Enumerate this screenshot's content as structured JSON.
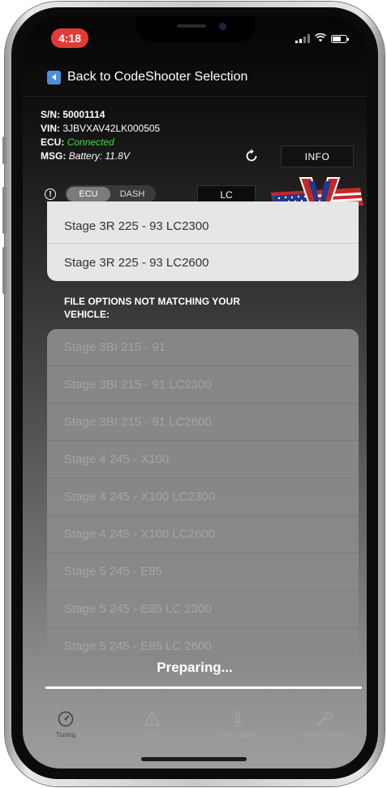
{
  "status_bar": {
    "time": "4:18"
  },
  "header": {
    "back_label": "Back to CodeShooter Selection"
  },
  "device_info": {
    "sn_label": "S/N:",
    "sn_value": "50001114",
    "vin_label": "VIN:",
    "vin_value": "3JBVXAV42LK000505",
    "ecu_label": "ECU:",
    "ecu_value": "Connected",
    "msg_label": "MSG:",
    "msg_value": "Battery: 11.8V"
  },
  "controls": {
    "info_button": "INFO",
    "toggle_ecu": "ECU",
    "toggle_dash": "DASH",
    "lc_button": "LC"
  },
  "matching_files": [
    "Stage 3R 225 - 93 LC2300",
    "Stage 3R 225 - 93 LC2600"
  ],
  "non_matching_title": "FILE OPTIONS NOT MATCHING YOUR VEHICLE:",
  "non_matching_files": [
    "Stage 3BI 215 - 91",
    "Stage 3BI 215 - 91 LC2300",
    "Stage 3BI 215 - 91 LC2600",
    "Stage 4 245 - X100",
    "Stage 4 245 - X100 LC2300",
    "Stage 4 245 - X100 LC2600",
    "Stage 5 245 - E85",
    "Stage 5 245 - E85 LC 2300",
    "Stage 5 245 - E85 LC 2600"
  ],
  "overlay": {
    "text": "Preparing...",
    "progress_fraction": 1.0
  },
  "tabs": [
    {
      "label": "Tuning",
      "icon": "gauge-icon",
      "active": true
    },
    {
      "label": "DTCs",
      "icon": "warning-icon",
      "active": false
    },
    {
      "label": "Data Logging",
      "icon": "thermometer-icon",
      "active": false
    },
    {
      "label": "Device Settings",
      "icon": "wrench-icon",
      "active": false
    }
  ],
  "colors": {
    "status_time_bg": "#e53935",
    "connected_text": "#3ddc3d",
    "back_icon": "#4a90d9"
  }
}
